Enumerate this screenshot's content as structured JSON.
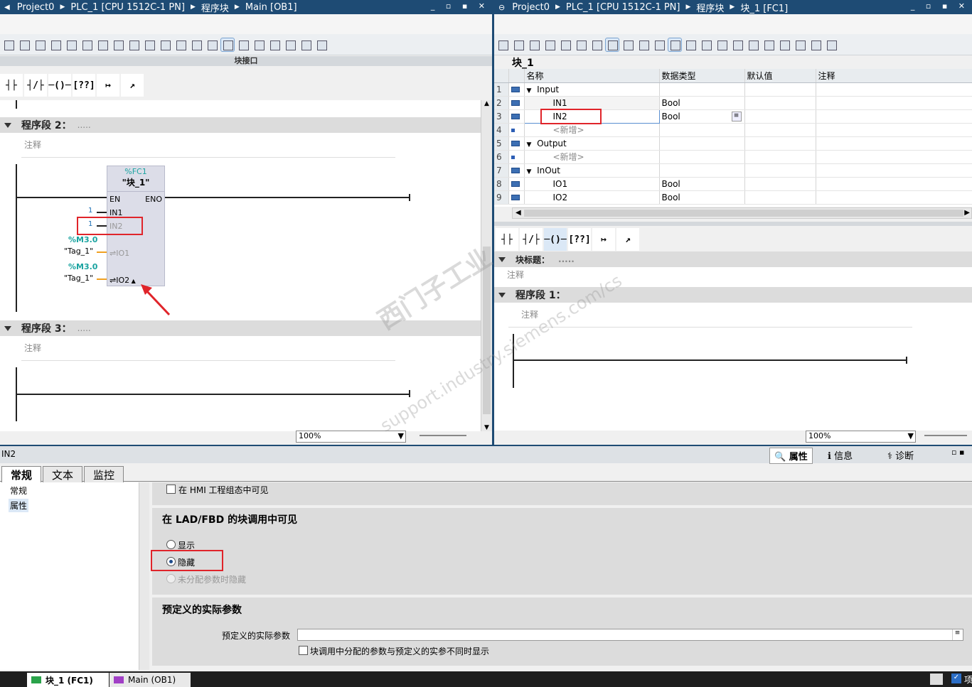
{
  "left_window": {
    "title_parts": [
      "Project0",
      "PLC_1 [CPU 1512C-1 PN]",
      "程序块",
      "Main [OB1]"
    ],
    "interface_bar": "块接口"
  },
  "right_window": {
    "title_parts": [
      "Project0",
      "PLC_1 [CPU 1512C-1 PN]",
      "程序块",
      "块_1 [FC1]"
    ],
    "block_name": "块_1"
  },
  "ladder_buttons": [
    "┤├",
    "┤/├",
    "─()─",
    "[??]",
    "↦",
    "↗"
  ],
  "left_editor": {
    "network2": {
      "label": "程序段 2：",
      "dots": ".....",
      "comment": "注释"
    },
    "network3": {
      "label": "程序段 3：",
      "dots": ".....",
      "comment": "注释"
    },
    "fc": {
      "address": "%FC1",
      "name": "\"块_1\"",
      "en": "EN",
      "eno": "ENO",
      "in1": "IN1",
      "in2": "IN2",
      "io1": "IO1",
      "io2": "IO2",
      "in1_val": "1",
      "in2_val": "1",
      "m1_addr": "%M3.0",
      "m1_tag": "\"Tag_1\"",
      "m2_addr": "%M3.0",
      "m2_tag": "\"Tag_1\""
    },
    "zoom": "100%"
  },
  "interface_table": {
    "headers": [
      "名称",
      "数据类型",
      "默认值",
      "注释"
    ],
    "rows": [
      {
        "n": "1",
        "name": "Input",
        "type": ""
      },
      {
        "n": "2",
        "name": "IN1",
        "type": "Bool"
      },
      {
        "n": "3",
        "name": "IN2",
        "type": "Bool"
      },
      {
        "n": "4",
        "name": "<新增>",
        "type": ""
      },
      {
        "n": "5",
        "name": "Output",
        "type": ""
      },
      {
        "n": "6",
        "name": "<新增>",
        "type": ""
      },
      {
        "n": "7",
        "name": "InOut",
        "type": ""
      },
      {
        "n": "8",
        "name": "IO1",
        "type": "Bool"
      },
      {
        "n": "9",
        "name": "IO2",
        "type": "Bool"
      }
    ]
  },
  "right_editor": {
    "block_title": "块标题：",
    "block_dots": ".....",
    "block_comment": "注释",
    "network1": "程序段 1：",
    "net_comment": "注释",
    "zoom": "100%"
  },
  "inspector": {
    "title": "IN2",
    "right_tabs": [
      "属性",
      "信息",
      "诊断"
    ],
    "tabs": [
      "常规",
      "文本",
      "监控"
    ],
    "nav": [
      "常规",
      "属性"
    ],
    "hmi_checkbox": "在 HMI 工程组态中可见",
    "visibility_header": "在 LAD/FBD 的块调用中可见",
    "options": [
      "显示",
      "隐藏",
      "未分配参数时隐藏"
    ],
    "predef_header": "预定义的实际参数",
    "predef_label": "预定义的实际参数",
    "predef_check": "块调用中分配的参数与预定义的实参不同时显示"
  },
  "statusbar": {
    "tabs": [
      "块_1 (FC1)",
      "Main (OB1)"
    ],
    "right": "项"
  },
  "watermark": [
    "西门子工业",
    "support.industry.siemens.com/cs"
  ]
}
